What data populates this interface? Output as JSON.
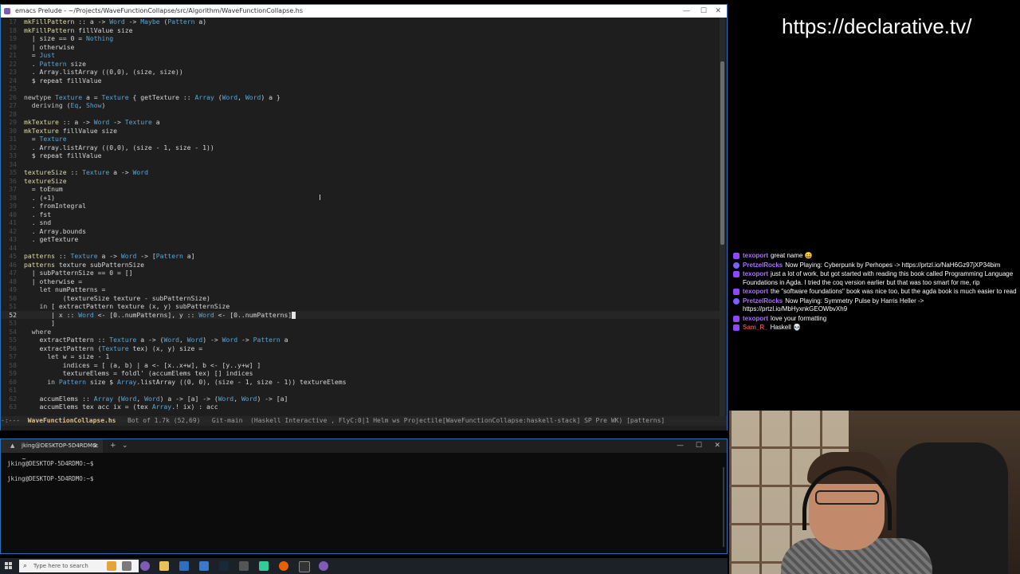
{
  "emacs": {
    "title": "emacs Prelude - ~/Projects/WaveFunctionCollapse/src/Algorithm/WaveFunctionCollapse.hs",
    "lines": [
      {
        "n": "17",
        "segs": [
          [
            "fn",
            "mkFillPattern"
          ],
          [
            "op",
            " :: a -> "
          ],
          [
            "ty",
            "Word"
          ],
          [
            "op",
            " -> "
          ],
          [
            "ty",
            "Maybe"
          ],
          [
            "op",
            " ("
          ],
          [
            "ty",
            "Pattern"
          ],
          [
            "op",
            " a)"
          ]
        ]
      },
      {
        "n": "18",
        "segs": [
          [
            "fn",
            "mkFillPattern"
          ],
          [
            "op",
            " fillValue size"
          ]
        ]
      },
      {
        "n": "19",
        "segs": [
          [
            "op",
            "  | size == 0 = "
          ],
          [
            "ty",
            "Nothing"
          ]
        ]
      },
      {
        "n": "20",
        "segs": [
          [
            "op",
            "  | otherwise"
          ]
        ]
      },
      {
        "n": "21",
        "segs": [
          [
            "op",
            "  = "
          ],
          [
            "ty",
            "Just"
          ]
        ]
      },
      {
        "n": "22",
        "segs": [
          [
            "op",
            "  . "
          ],
          [
            "ty",
            "Pattern"
          ],
          [
            "op",
            " size"
          ]
        ]
      },
      {
        "n": "23",
        "segs": [
          [
            "op",
            "  . Array.listArray ((0,0), (size, size))"
          ]
        ]
      },
      {
        "n": "24",
        "segs": [
          [
            "op",
            "  $ repeat fillValue"
          ]
        ]
      },
      {
        "n": "25",
        "segs": [
          [
            "op",
            ""
          ]
        ]
      },
      {
        "n": "26",
        "segs": [
          [
            "kw",
            "newtype"
          ],
          [
            "op",
            " "
          ],
          [
            "ty",
            "Texture"
          ],
          [
            "op",
            " a = "
          ],
          [
            "ty",
            "Texture"
          ],
          [
            "op",
            " { getTexture :: "
          ],
          [
            "ty",
            "Array"
          ],
          [
            "op",
            " ("
          ],
          [
            "ty",
            "Word"
          ],
          [
            "op",
            ", "
          ],
          [
            "ty",
            "Word"
          ],
          [
            "op",
            ") a }"
          ]
        ]
      },
      {
        "n": "27",
        "segs": [
          [
            "op",
            "  "
          ],
          [
            "kw",
            "deriving"
          ],
          [
            "op",
            " ("
          ],
          [
            "ty",
            "Eq"
          ],
          [
            "op",
            ", "
          ],
          [
            "ty",
            "Show"
          ],
          [
            "op",
            ")"
          ]
        ]
      },
      {
        "n": "28",
        "segs": [
          [
            "op",
            ""
          ]
        ]
      },
      {
        "n": "29",
        "segs": [
          [
            "fn",
            "mkTexture"
          ],
          [
            "op",
            " :: a -> "
          ],
          [
            "ty",
            "Word"
          ],
          [
            "op",
            " -> "
          ],
          [
            "ty",
            "Texture"
          ],
          [
            "op",
            " a"
          ]
        ]
      },
      {
        "n": "30",
        "segs": [
          [
            "fn",
            "mkTexture"
          ],
          [
            "op",
            " fillValue size"
          ]
        ]
      },
      {
        "n": "31",
        "segs": [
          [
            "op",
            "  = "
          ],
          [
            "ty",
            "Texture"
          ]
        ]
      },
      {
        "n": "32",
        "segs": [
          [
            "op",
            "  . Array.listArray ((0,0), (size - 1, size - 1))"
          ]
        ]
      },
      {
        "n": "33",
        "segs": [
          [
            "op",
            "  $ repeat fillValue"
          ]
        ]
      },
      {
        "n": "34",
        "segs": [
          [
            "op",
            ""
          ]
        ]
      },
      {
        "n": "35",
        "segs": [
          [
            "fn",
            "textureSize"
          ],
          [
            "op",
            " :: "
          ],
          [
            "ty",
            "Texture"
          ],
          [
            "op",
            " a -> "
          ],
          [
            "ty",
            "Word"
          ]
        ]
      },
      {
        "n": "36",
        "segs": [
          [
            "fn",
            "textureSize"
          ]
        ]
      },
      {
        "n": "37",
        "segs": [
          [
            "op",
            "  = toEnum"
          ]
        ]
      },
      {
        "n": "38",
        "segs": [
          [
            "op",
            "  . (+1)"
          ]
        ]
      },
      {
        "n": "39",
        "segs": [
          [
            "op",
            "  . fromIntegral"
          ]
        ]
      },
      {
        "n": "40",
        "segs": [
          [
            "op",
            "  . fst"
          ]
        ]
      },
      {
        "n": "41",
        "segs": [
          [
            "op",
            "  . snd"
          ]
        ]
      },
      {
        "n": "42",
        "segs": [
          [
            "op",
            "  . Array.bounds"
          ]
        ]
      },
      {
        "n": "43",
        "segs": [
          [
            "op",
            "  . getTexture"
          ]
        ]
      },
      {
        "n": "44",
        "segs": [
          [
            "op",
            ""
          ]
        ]
      },
      {
        "n": "45",
        "segs": [
          [
            "fn",
            "patterns"
          ],
          [
            "op",
            " :: "
          ],
          [
            "ty",
            "Texture"
          ],
          [
            "op",
            " a -> "
          ],
          [
            "ty",
            "Word"
          ],
          [
            "op",
            " -> ["
          ],
          [
            "ty",
            "Pattern"
          ],
          [
            "op",
            " a]"
          ]
        ]
      },
      {
        "n": "46",
        "segs": [
          [
            "fn",
            "patterns"
          ],
          [
            "op",
            " texture subPatternSize"
          ]
        ]
      },
      {
        "n": "47",
        "segs": [
          [
            "op",
            "  | subPatternSize == 0 = []"
          ]
        ]
      },
      {
        "n": "48",
        "segs": [
          [
            "op",
            "  | otherwise ="
          ]
        ]
      },
      {
        "n": "49",
        "segs": [
          [
            "op",
            "    "
          ],
          [
            "kw",
            "let"
          ],
          [
            "op",
            " numPatterns ="
          ]
        ]
      },
      {
        "n": "50",
        "segs": [
          [
            "op",
            "          (textureSize texture - subPatternSize)"
          ]
        ]
      },
      {
        "n": "51",
        "segs": [
          [
            "op",
            "    "
          ],
          [
            "kw",
            "in"
          ],
          [
            "op",
            " [ extractPattern texture (x, y) subPatternSize"
          ]
        ]
      },
      {
        "n": "52",
        "cur": true,
        "segs": [
          [
            "op",
            "       | x :: "
          ],
          [
            "ty",
            "Word"
          ],
          [
            "op",
            " <- [0..numPatterns], y :: "
          ],
          [
            "ty",
            "Word"
          ],
          [
            "op",
            " <- [0..numPatterns]"
          ]
        ]
      },
      {
        "n": "53",
        "segs": [
          [
            "op",
            "       ]"
          ]
        ]
      },
      {
        "n": "54",
        "segs": [
          [
            "op",
            "  "
          ],
          [
            "kw",
            "where"
          ]
        ]
      },
      {
        "n": "55",
        "segs": [
          [
            "op",
            "    extractPattern :: "
          ],
          [
            "ty",
            "Texture"
          ],
          [
            "op",
            " a -> ("
          ],
          [
            "ty",
            "Word"
          ],
          [
            "op",
            ", "
          ],
          [
            "ty",
            "Word"
          ],
          [
            "op",
            ") -> "
          ],
          [
            "ty",
            "Word"
          ],
          [
            "op",
            " -> "
          ],
          [
            "ty",
            "Pattern"
          ],
          [
            "op",
            " a"
          ]
        ]
      },
      {
        "n": "56",
        "segs": [
          [
            "op",
            "    extractPattern ("
          ],
          [
            "ty",
            "Texture"
          ],
          [
            "op",
            " tex) (x, y) size ="
          ]
        ]
      },
      {
        "n": "57",
        "segs": [
          [
            "op",
            "      "
          ],
          [
            "kw",
            "let"
          ],
          [
            "op",
            " w = size - 1"
          ]
        ]
      },
      {
        "n": "58",
        "segs": [
          [
            "op",
            "          indices = [ (a, b) | a <- [x..x+w], b <- [y..y+w] ]"
          ]
        ]
      },
      {
        "n": "59",
        "segs": [
          [
            "op",
            "          textureElems = foldl' (accumElems tex) [] indices"
          ]
        ]
      },
      {
        "n": "60",
        "segs": [
          [
            "op",
            "      "
          ],
          [
            "kw",
            "in"
          ],
          [
            "op",
            " "
          ],
          [
            "ty",
            "Pattern"
          ],
          [
            "op",
            " size $ "
          ],
          [
            "ty",
            "Array"
          ],
          [
            "op",
            ".listArray ((0, 0), (size - 1, size - 1)) textureElems"
          ]
        ]
      },
      {
        "n": "61",
        "segs": [
          [
            "op",
            ""
          ]
        ]
      },
      {
        "n": "62",
        "segs": [
          [
            "op",
            "    accumElems :: "
          ],
          [
            "ty",
            "Array"
          ],
          [
            "op",
            " ("
          ],
          [
            "ty",
            "Word"
          ],
          [
            "op",
            ", "
          ],
          [
            "ty",
            "Word"
          ],
          [
            "op",
            ") a -> [a] -> ("
          ],
          [
            "ty",
            "Word"
          ],
          [
            "op",
            ", "
          ],
          [
            "ty",
            "Word"
          ],
          [
            "op",
            ") -> [a]"
          ]
        ]
      },
      {
        "n": "63",
        "segs": [
          [
            "op",
            "    accumElems tex acc ix = (tex "
          ],
          [
            "ty",
            "Array"
          ],
          [
            "op",
            ".! ix) : acc"
          ]
        ]
      }
    ],
    "modeline": {
      "prefix": "-:---  ",
      "filename": "WaveFunctionCollapse.hs",
      "rest": "   Bot of 1.7k (52,69)   Git-main  (Haskell Interactive , FlyC:0|1 Helm ws Projectile[WaveFunctionCollapse:haskell-stack] SP Pre WK) [patterns]"
    }
  },
  "terminal": {
    "tab_title": "jking@DESKTOP-5D4RDMO: ~",
    "prompt_lines": [
      "jking@DESKTOP-5D4RDMO:~$",
      "jking@DESKTOP-5D4RDMO:~$"
    ]
  },
  "taskbar": {
    "search_placeholder": "Type here to search"
  },
  "stream": {
    "url": "https://declarative.tv/",
    "chat": [
      {
        "user": "texoport",
        "msg": "great name 😄"
      },
      {
        "user": "PretzelRocks",
        "msg": "Now Playing: Cyberpunk by Perhopes -> https://prtzl.io/NaH6Gz97jXP34bim"
      },
      {
        "user": "texoport",
        "msg": "just a lot of work, but got started with reading this book called Programming Language Foundations in Agda. I tried the coq version earlier but that was too smart for me, rip"
      },
      {
        "user": "texoport",
        "msg": "the \"software foundations\" book was nice too, but the agda book is much easier to read"
      },
      {
        "user": "PretzelRocks",
        "msg": "Now Playing: Symmetry Pulse by Harris Heller -> https://prtzl.io/MbHyxnkGEOWbvXh9"
      },
      {
        "user": "texoport",
        "msg": "love your formatting"
      },
      {
        "user": "Sam_R_",
        "msg": "Haskell 💀",
        "red": true
      }
    ]
  },
  "colors": {
    "emacs_bg": "#1e1e1e",
    "type_color": "#5aa6d4",
    "function_color": "#dcdcaa",
    "chat_user": "#a970ff"
  }
}
